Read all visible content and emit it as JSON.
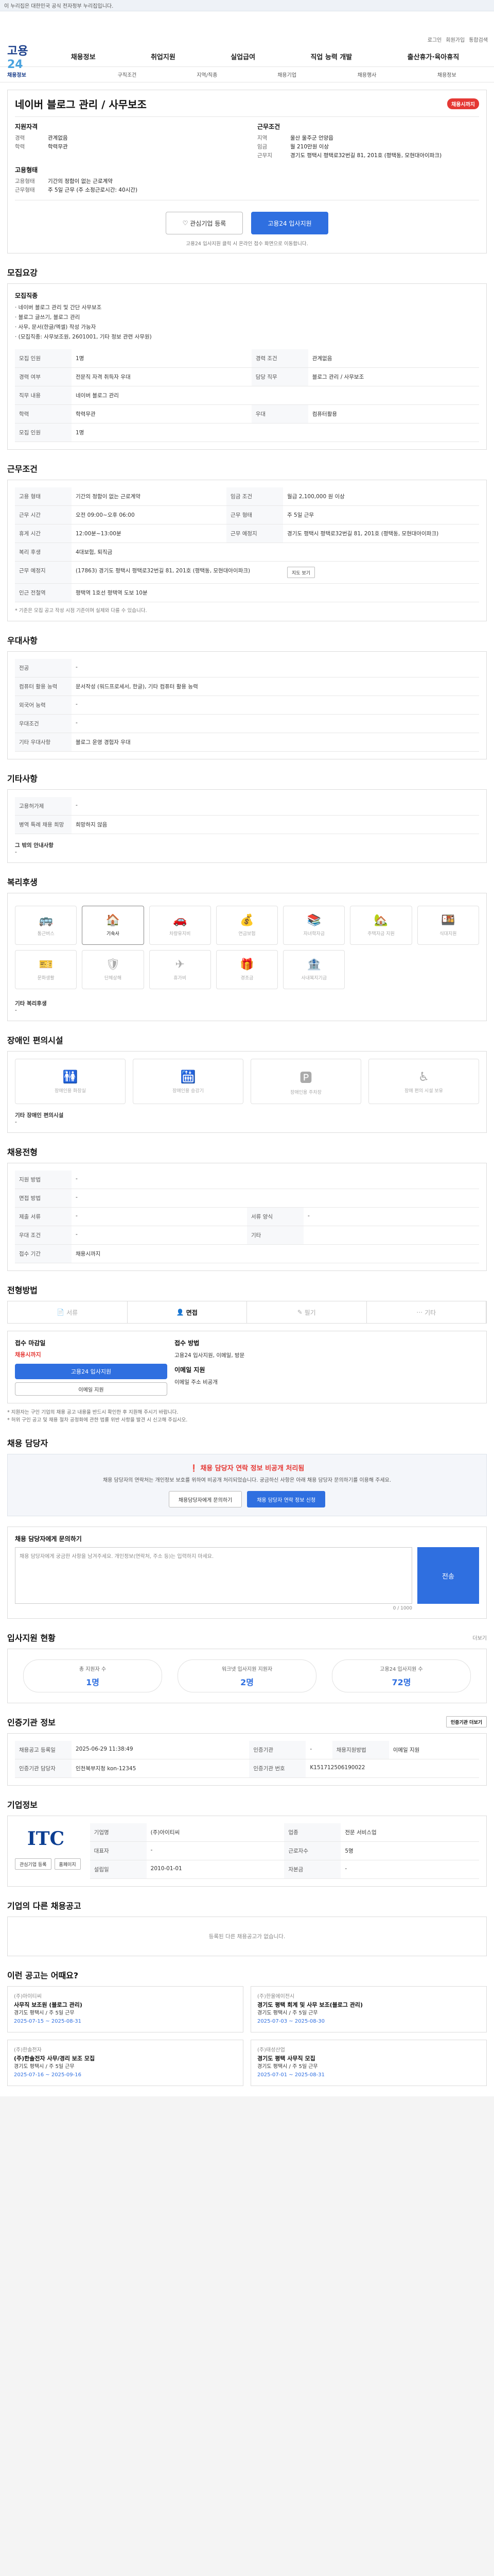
{
  "topbar": {
    "text": "이 누리집은 대한민국 공식 전자정부 누리집입니다."
  },
  "access": [
    "로그인",
    "회원가입",
    "통합검색"
  ],
  "logo": {
    "a": "고용",
    "b": "24"
  },
  "gnb": [
    "채용정보",
    "취업지원",
    "실업급여",
    "직업 능력 개발",
    "출산휴가·육아휴직"
  ],
  "subnav": [
    "채용정보",
    "구직조건",
    "지역/직종",
    "채용기업",
    "채용행사",
    "채용정보"
  ],
  "job": {
    "title": "네이버 블로그 관리 / 사무보조",
    "badge": "채용시까지",
    "left_head": "지원자격",
    "career_k": "경력",
    "career_v": "관계없음",
    "edu_k": "학력",
    "edu_v": "학력무관",
    "right_head": "근무조건",
    "region_k": "지역",
    "region_v": "울산 울주군 언양읍",
    "pay_k": "임금",
    "pay_v": "월 210만원 이상",
    "type_head": "고용형태",
    "etype_k": "고용형태",
    "etype_v": "기간의 정함이 없는 근로계약",
    "work_k": "근무형태",
    "work_v": "주 5일 근무 (주 소정근로시간: 40시간)",
    "addr_k": "근무지",
    "addr_v": "경기도 평택시 평택로32번길 81, 201호 (평택동, 모현대아이파크)"
  },
  "buttons": {
    "interest": "관심기업 등록",
    "apply": "고용24 입사지원"
  },
  "apply_note": "고용24 입사지원 클릭 시 온라인 접수 화면으로 이동합니다.",
  "s1": {
    "title": "모집요강",
    "sub": "모집직종",
    "desc": [
      "· 네이버 블로그 관리 및 간단 사무보조",
      "· 블로그 글쓰기, 블로그 관리",
      "· 사무, 문서(한글/엑셀) 작성 가능자",
      "· (모집직종: 사무보조원, 2601001, 기타 정보 관련 사무원)"
    ],
    "rows": [
      [
        "모집 인원",
        "1명",
        "경력 조건",
        "관계없음"
      ],
      [
        "경력 여부",
        "전문직 자격 취득자 우대",
        "담당 직무",
        "블로그 관리 / 사무보조"
      ],
      [
        "직무 내용",
        "네이버 블로그 관리",
        "",
        ""
      ],
      [
        "학력",
        "학력무관",
        "우대",
        "컴퓨터활용"
      ],
      [
        "모집 인원",
        "1명",
        "",
        ""
      ]
    ]
  },
  "s2": {
    "title": "근무조건",
    "rows": [
      [
        "고용 형태",
        "기간의 정함이 없는 근로계약",
        "임금 조건",
        "월급 2,100,000 원 이상"
      ],
      [
        "근무 시간",
        "오전 09:00~오후 06:00",
        "근무 형태",
        "주 5일 근무"
      ],
      [
        "휴게 시간",
        "12:00분~13:00분",
        "근무 예정지",
        "경기도 평택시 평택로32번길 81, 201호 (평택동, 모현대아이파크)"
      ],
      [
        "복리 후생",
        "4대보험, 퇴직금",
        "",
        ""
      ],
      [
        "근무 예정지",
        "(17863) 경기도 평택시 평택로32번길 81, 201호 (평택동, 모현대아이파크)",
        "지도 보기",
        ""
      ],
      [
        "인근 전철역",
        "평택역 1호선 평택역 도보 10분",
        "",
        ""
      ]
    ],
    "note": "* 기준은 모집 공고 작성 시점 기준이며 실제와 다를 수 있습니다."
  },
  "s3": {
    "title": "우대사항",
    "rows": [
      [
        "전공",
        "-"
      ],
      [
        "컴퓨터 활용 능력",
        "문서작성 (워드프로세서, 한글), 기타 컴퓨터 활용 능력"
      ],
      [
        "외국어 능력",
        "-"
      ],
      [
        "우대조건",
        "-"
      ],
      [
        "기타 우대사항",
        "블로그 운영 경험자 우대"
      ]
    ]
  },
  "s4": {
    "title": "기타사항",
    "rows": [
      [
        "고용허가제",
        "-"
      ],
      [
        "병역 특례 채용 희망",
        "희망하지 않음"
      ]
    ],
    "etc_k": "그 밖의 안내사항",
    "etc_v": "-"
  },
  "s5": {
    "title": "복리후생",
    "items": [
      "통근버스",
      "기숙사",
      "차량유지비",
      "연금보험",
      "자녀학자금",
      "주택자금 지원",
      "식대지원",
      "문화생활",
      "단체상해",
      "휴가비",
      "경조금",
      "사내복지기금"
    ],
    "on_index": 1,
    "note_k": "기타 복리후생",
    "note_v": "-"
  },
  "s6": {
    "title": "장애인 편의시설",
    "items": [
      "장애인용 화장실",
      "장애인용 승강기",
      "장애인용 주차장",
      "장애 편의 시설 보유"
    ],
    "note_k": "기타 장애인 편의시설",
    "note_v": "-"
  },
  "s7": {
    "title": "채용전형",
    "rows": [
      [
        "지원 방법",
        "-",
        "",
        ""
      ],
      [
        "면접 방법",
        "-",
        "",
        ""
      ],
      [
        "제출 서류",
        "-",
        "서류 양식",
        "-"
      ],
      [
        "우대 조건",
        "-",
        "",
        "기타"
      ],
      [
        "접수 기간",
        "채용시까지",
        "",
        ""
      ]
    ]
  },
  "s8": {
    "title": "전형방법",
    "tabs": [
      "서류",
      "면접",
      "필기",
      "기타"
    ],
    "on_index": 1,
    "apply_k": "접수 마감일",
    "apply_v": "채용시까지",
    "apply_btn": "고용24 입사지원",
    "email_btn": "이메일 지원",
    "method_k": "접수 방법",
    "method_v": "고용24 입사지원, 이메일, 방문",
    "contact_k": "이메일 지원",
    "contact_v": "이메일 주소 비공개"
  },
  "bullets": [
    "* 지원자는 구인 기업의 채용 공고 내용을 반드시 확인한 후 지원해 주시기 바랍니다.",
    "* 허위 구인 공고 및 채용 절차 공정화에 관한 법률 위반 사항을 발견 시 신고해 주십시오."
  ],
  "s9": {
    "title": "채용 담당자",
    "warn_t": "채용 담당자 연락 정보 비공개 처리됨",
    "warn_p": "채용 담당자의 연락처는 개인정보 보호를 위하여 비공개 처리되었습니다. 궁금하신 사항은 아래 채용 담당자 문의하기를 이용해 주세요.",
    "btn1": "채용담당자에게 문의하기",
    "btn2": "채용 담당자 연락 정보 신청"
  },
  "s10": {
    "title": "채용 담당자에게 문의하기",
    "hint": "채용 담당자에게 궁금한 사항을 남겨주세요. 개인정보(연락처, 주소 등)는 입력하지 마세요.",
    "count": "0 / 1000",
    "send": "전송"
  },
  "s11": {
    "title": "입사지원 현황",
    "more": "더보기",
    "stats": [
      [
        "총 지원자 수",
        "1명"
      ],
      [
        "워크넷 입사지원 지원자",
        "2명"
      ],
      [
        "고용24 입사지원 수",
        "72명"
      ]
    ]
  },
  "s12": {
    "title": "인증기관 정보",
    "btn": "인증기관 더보기",
    "rows": [
      [
        "채용공고 등록일",
        "2025-06-29 11:38:49",
        "인증기관",
        "-",
        "채용지원방법",
        "이메일 지원"
      ],
      [
        "인증기관 담당자",
        "인천북부지청 kon-12345",
        "인증기관 번호",
        "K151712506190022",
        "",
        ""
      ]
    ]
  },
  "s13": {
    "title": "기업정보",
    "name": "ITC",
    "info": [
      [
        "기업명",
        "(주)아이티씨",
        "업종",
        "전문 서비스업"
      ],
      [
        "대표자",
        "-",
        "근로자수",
        "5명"
      ],
      [
        "설립일",
        "2010-01-01",
        "자본금",
        "-"
      ]
    ],
    "btns": [
      "관심기업 등록",
      "홈페이지"
    ]
  },
  "s14": {
    "title": "기업의 다른 채용공고",
    "empty": "등록된 다른 채용공고가 없습니다."
  },
  "s15": {
    "title": "이런 공고는 어때요?",
    "cards": [
      [
        "(주)아이티씨",
        "사무직 보조원 (블로그 관리)",
        "경기도 평택시 / 주 5일 근무",
        "2025-07-15 ~ 2025-08-31"
      ],
      [
        "(주)한울에이전시",
        "경기도 평택 회계 및 사무 보조(블로그 관리)",
        "경기도 평택시 / 주 5일 근무",
        "2025-07-03 ~ 2025-08-30"
      ],
      [
        "(주)한솔전자",
        "(주)한솔전자 사무/경리 보조 모집",
        "경기도 평택시 / 주 5일 근무",
        "2025-07-16 ~ 2025-09-16"
      ],
      [
        "(주)태성산업",
        "경기도 평택 사무직 모집",
        "경기도 평택시 / 주 5일 근무",
        "2025-07-01 ~ 2025-08-31"
      ]
    ]
  }
}
